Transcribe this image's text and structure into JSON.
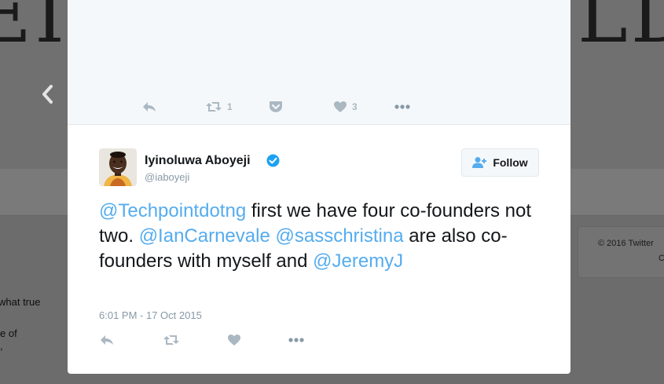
{
  "background": {
    "banner_left": "EI",
    "banner_right": "LD",
    "text_lines": [
      "what true",
      "e of",
      ","
    ],
    "footer_copyright": "© 2016 Twitter",
    "footer_letter": "C"
  },
  "previous_tweet": {
    "retweet_count": "1",
    "like_count": "3"
  },
  "tweet": {
    "author": {
      "fullname": "Iyinoluwa Aboyeji",
      "username": "@iaboyeji",
      "verified": true
    },
    "follow_label": "Follow",
    "text_segments": [
      {
        "text": "@Techpointdotng",
        "type": "mention"
      },
      {
        "text": " first we have four co-founders not two. ",
        "type": "text"
      },
      {
        "text": "@IanCarnevale",
        "type": "mention"
      },
      {
        "text": " ",
        "type": "text"
      },
      {
        "text": "@sasschristina",
        "type": "mention"
      },
      {
        "text": " are also co-founders with myself and ",
        "type": "text"
      },
      {
        "text": "@JeremyJ",
        "type": "mention"
      }
    ],
    "timestamp": "6:01 PM - 17 Oct 2015"
  },
  "colors": {
    "accent": "#55acee",
    "verified": "#1da1f2",
    "icon_gray": "#aab8c2",
    "icon_dark": "#8899a6"
  }
}
